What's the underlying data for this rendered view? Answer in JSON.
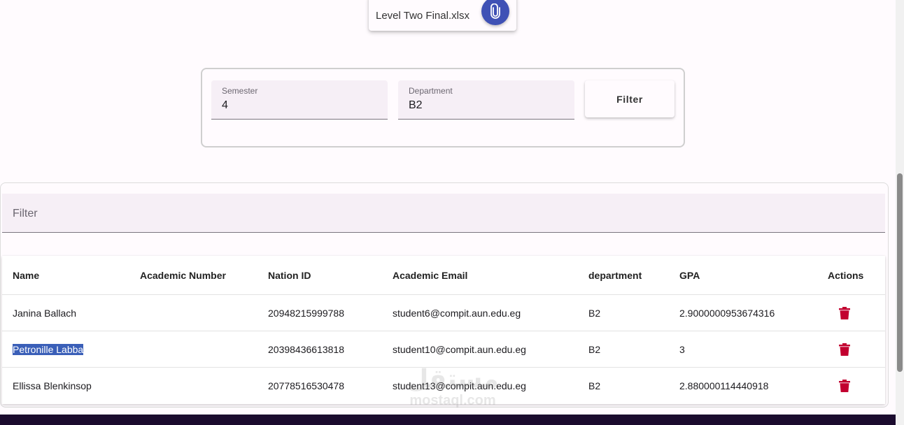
{
  "upload": {
    "file_name": "Level Two Final.xlsx",
    "icon": "paperclip-icon"
  },
  "filters": {
    "semester_label": "Semester",
    "semester_value": "4",
    "department_label": "Department",
    "department_value": "B2",
    "filter_button": "Filter"
  },
  "table_filter": {
    "placeholder": "Filter"
  },
  "table": {
    "columns": [
      "Name",
      "Academic Number",
      "Nation ID",
      "Academic Email",
      "department",
      "GPA",
      "Actions"
    ],
    "rows": [
      {
        "name": "Janina Ballach",
        "academic_number": "",
        "nation_id": "20948215999788",
        "email": "student6@compit.aun.edu.eg",
        "department": "B2",
        "gpa": "2.9000000953674316"
      },
      {
        "name": "Petronille Labba",
        "academic_number": "",
        "nation_id": "20398436613818",
        "email": "student10@compit.aun.edu.eg",
        "department": "B2",
        "gpa": "3"
      },
      {
        "name": "Ellissa Blenkinsop",
        "academic_number": "",
        "nation_id": "20778516530478",
        "email": "student13@compit.aun.edu.eg",
        "department": "B2",
        "gpa": "2.880000114440918"
      }
    ]
  },
  "watermark": {
    "arabic": "مستقل",
    "latin": "mostaql.com"
  },
  "colors": {
    "accent": "#3f51b5",
    "delete": "#c2002f",
    "bottom_bar": "#1b0b2e"
  }
}
